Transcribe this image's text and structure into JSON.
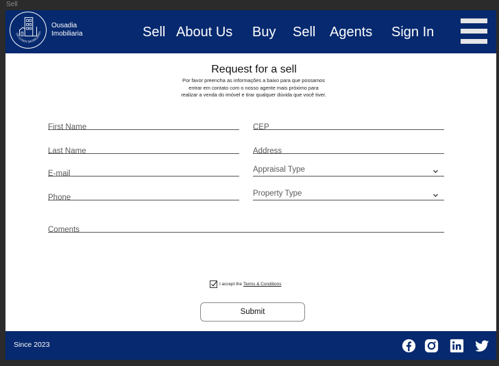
{
  "frame": {
    "label": "Sell"
  },
  "header": {
    "brand_line1": "Ousadia",
    "brand_line2": "Imobiliaria",
    "logo_text": "ON LUSEN IMOBILIARIA",
    "nav": [
      "Sell",
      "About Us",
      "Buy",
      "Sell",
      "Agents",
      "Sign In"
    ],
    "menu_icon": "hamburger-menu-icon"
  },
  "form": {
    "title": "Request for a sell",
    "subtitle": "Por favor preencha as informações a baixo para que possamos entrar em contato com o nosso agente mais próximo para realizar a venda do imóvel e tirar qualquer dúvida que você tiver.",
    "placeholders": {
      "first_name": "First Name",
      "cep": "CEP",
      "last_name": "Last Name",
      "address": "Address",
      "email": "E-mail",
      "phone": "Phone",
      "comments": "Coments"
    },
    "selects": {
      "appraisal_type": "Appraisal Type",
      "property_type": "Property Type"
    },
    "consent_text": "I accept the",
    "terms_link": "Terms & Conditions",
    "consent_checked": true,
    "submit_label": "Submit"
  },
  "footer": {
    "since": "Since 2023",
    "social": [
      "facebook-icon",
      "instagram-icon",
      "linkedin-icon",
      "twitter-icon"
    ]
  },
  "colors": {
    "brand_navy": "#06296f",
    "menu_bar": "#e6e6e6",
    "background": "#ffffff",
    "frame_bg": "#2b2b2b"
  }
}
